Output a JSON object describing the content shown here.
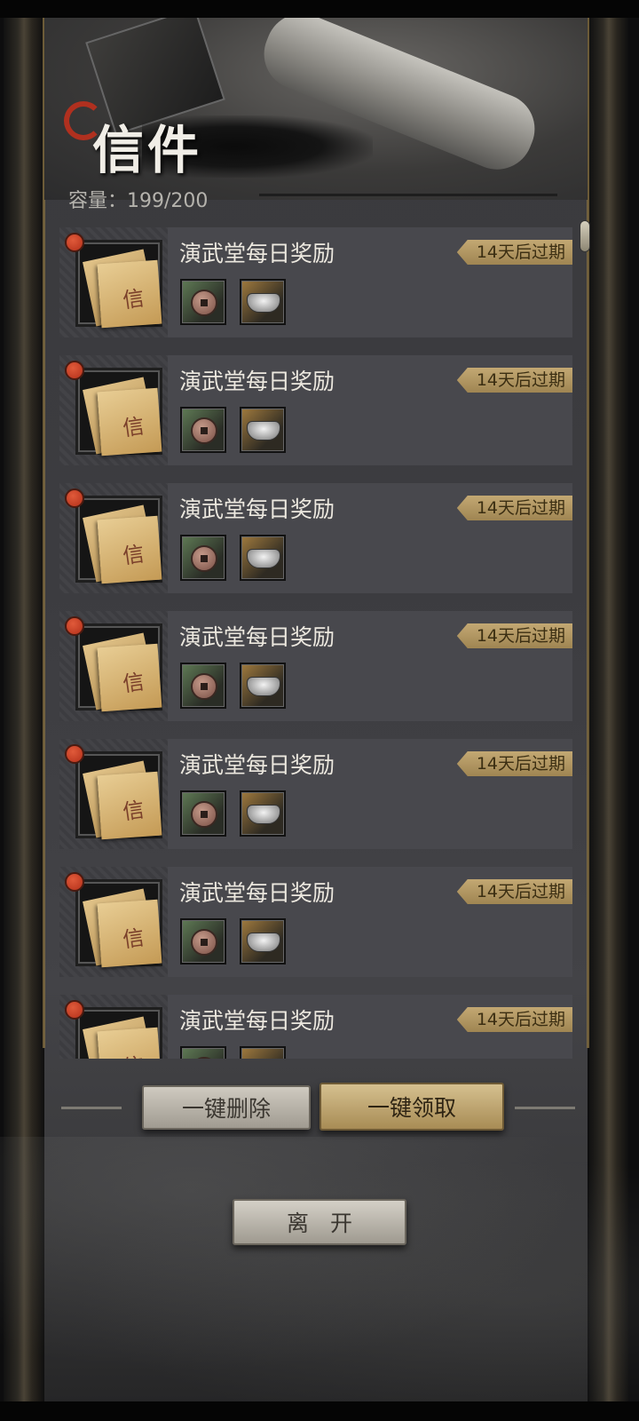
{
  "header": {
    "title": "信件",
    "capacity_label": "容量：",
    "capacity_value": "199/200"
  },
  "mails": [
    {
      "title": "演武堂每日奖励",
      "expire": "14天后过期",
      "unread": true,
      "rewards": [
        "coin-icon",
        "silver-ingot-icon"
      ]
    },
    {
      "title": "演武堂每日奖励",
      "expire": "14天后过期",
      "unread": true,
      "rewards": [
        "coin-icon",
        "silver-ingot-icon"
      ]
    },
    {
      "title": "演武堂每日奖励",
      "expire": "14天后过期",
      "unread": true,
      "rewards": [
        "coin-icon",
        "silver-ingot-icon"
      ]
    },
    {
      "title": "演武堂每日奖励",
      "expire": "14天后过期",
      "unread": true,
      "rewards": [
        "coin-icon",
        "silver-ingot-icon"
      ]
    },
    {
      "title": "演武堂每日奖励",
      "expire": "14天后过期",
      "unread": true,
      "rewards": [
        "coin-icon",
        "silver-ingot-icon"
      ]
    },
    {
      "title": "演武堂每日奖励",
      "expire": "14天后过期",
      "unread": true,
      "rewards": [
        "coin-icon",
        "silver-ingot-icon"
      ]
    },
    {
      "title": "演武堂每日奖励",
      "expire": "14天后过期",
      "unread": true,
      "rewards": [
        "coin-icon",
        "silver-ingot-icon"
      ]
    }
  ],
  "mail_thumb_glyph": "信",
  "actions": {
    "delete_all": "一键删除",
    "claim_all": "一键领取",
    "leave": "离开"
  },
  "colors": {
    "accent_gold": "#c3a873",
    "unread_dot": "#d0452a",
    "panel": "#3c3c40"
  }
}
